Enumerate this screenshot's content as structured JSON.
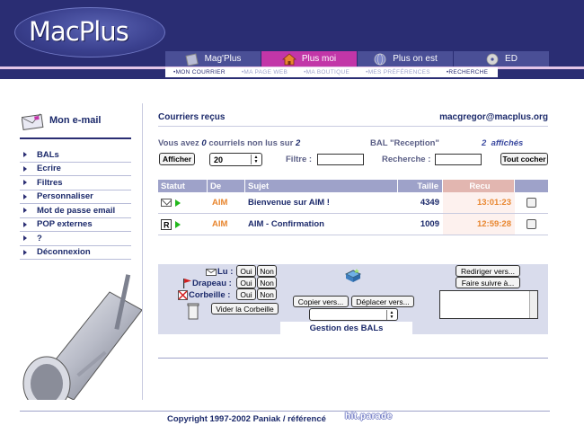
{
  "header": {
    "logo": "MacPlus",
    "tabs": [
      {
        "label": "Mag'Plus",
        "icon": "magazine-icon"
      },
      {
        "label": "Plus moi",
        "icon": "house-icon",
        "active": true
      },
      {
        "label": "Plus on est",
        "icon": "globe-icon"
      },
      {
        "label": "ED",
        "icon": "disc-icon"
      }
    ],
    "subnav": [
      "•MON COURRIER",
      "•MA PAGE WEB",
      "•MA BOUTIQUE",
      "•MES PRÉFÉRENCES",
      "•RECHERCHE"
    ]
  },
  "sidebar": {
    "title": "Mon e-mail",
    "items": [
      "BALs",
      "Ecrire",
      "Filtres",
      "Personnaliser",
      "Mot de passe email",
      "POP externes",
      "?",
      "Déconnexion"
    ]
  },
  "main": {
    "title": "Courriers reçus",
    "email": "macgregor@macplus.org",
    "info": {
      "prefix": "Vous avez",
      "unread": "0",
      "middle": "courriels non lus sur",
      "total": "2",
      "bal": "BAL \"Reception\"",
      "shown": "2",
      "shown_label": "affichés"
    },
    "controls": {
      "afficher": "Afficher",
      "count": "20",
      "filtre_label": "Filtre :",
      "filtre_value": "",
      "recherche_label": "Recherche :",
      "recherche_value": "",
      "tout_cocher": "Tout cocher"
    },
    "table": {
      "headers": [
        "Statut",
        "De",
        "Sujet",
        "Taille",
        "Recu"
      ],
      "rows": [
        {
          "status": "read-envelope-icon",
          "from": "AIM",
          "subject": "Bienvenue sur AIM !",
          "size": "4349",
          "received": "13:01:23"
        },
        {
          "status": "replied-icon",
          "from": "AIM",
          "subject": "AIM - Confirmation",
          "size": "1009",
          "received": "12:59:28"
        }
      ]
    }
  },
  "gestion": {
    "title": "Gestion des BALs",
    "lu": "Lu :",
    "drapeau": "Drapeau :",
    "corbeille": "Corbeille :",
    "oui": "Oui",
    "non": "Non",
    "vider": "Vider la Corbeille",
    "copier": "Copier vers...",
    "deplacer": "Déplacer vers...",
    "rediriger": "Rediriger vers...",
    "faire_suivre": "Faire suivre à..."
  },
  "footer": {
    "copyright": "Copyright 1997-2002 Paniak / référencé",
    "badge": "hit.parade"
  }
}
